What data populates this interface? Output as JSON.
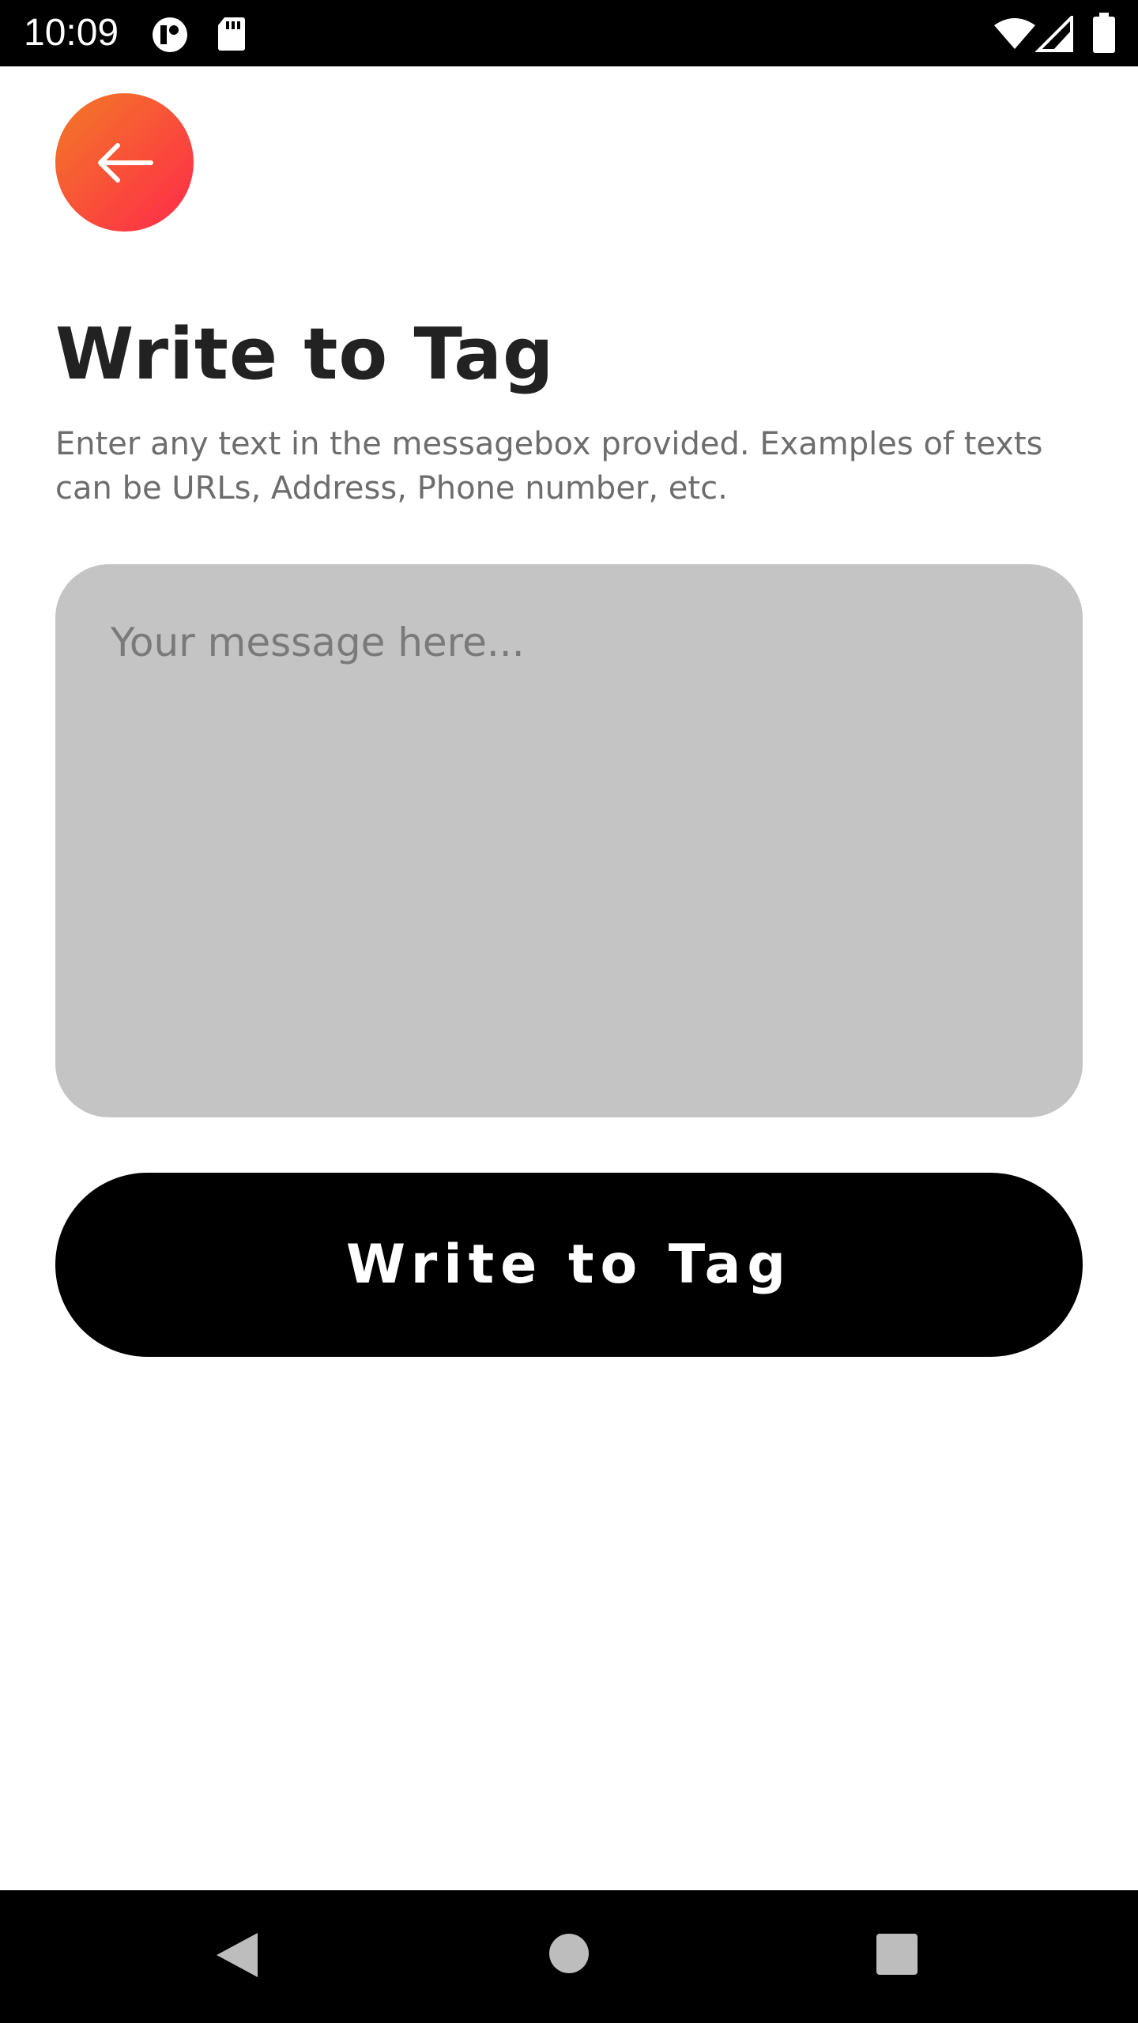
{
  "status_bar": {
    "time": "10:09",
    "icons": [
      "media-icon",
      "sd-card-icon",
      "wifi-icon",
      "cellular-signal-icon",
      "battery-icon"
    ]
  },
  "header": {
    "back_icon": "arrow-left-icon",
    "back_button_colors": [
      "#f27a26",
      "#ff2a4a"
    ]
  },
  "main": {
    "title": "Write to Tag",
    "description": "Enter any text in the messagebox provided. Examples of texts can be URLs, Address, Phone number, etc.",
    "message_input": {
      "placeholder": "Your message here...",
      "value": ""
    },
    "write_button_label": "Write to Tag"
  },
  "nav_bar": {
    "icons": [
      "back-triangle-icon",
      "home-circle-icon",
      "recents-square-icon"
    ]
  }
}
